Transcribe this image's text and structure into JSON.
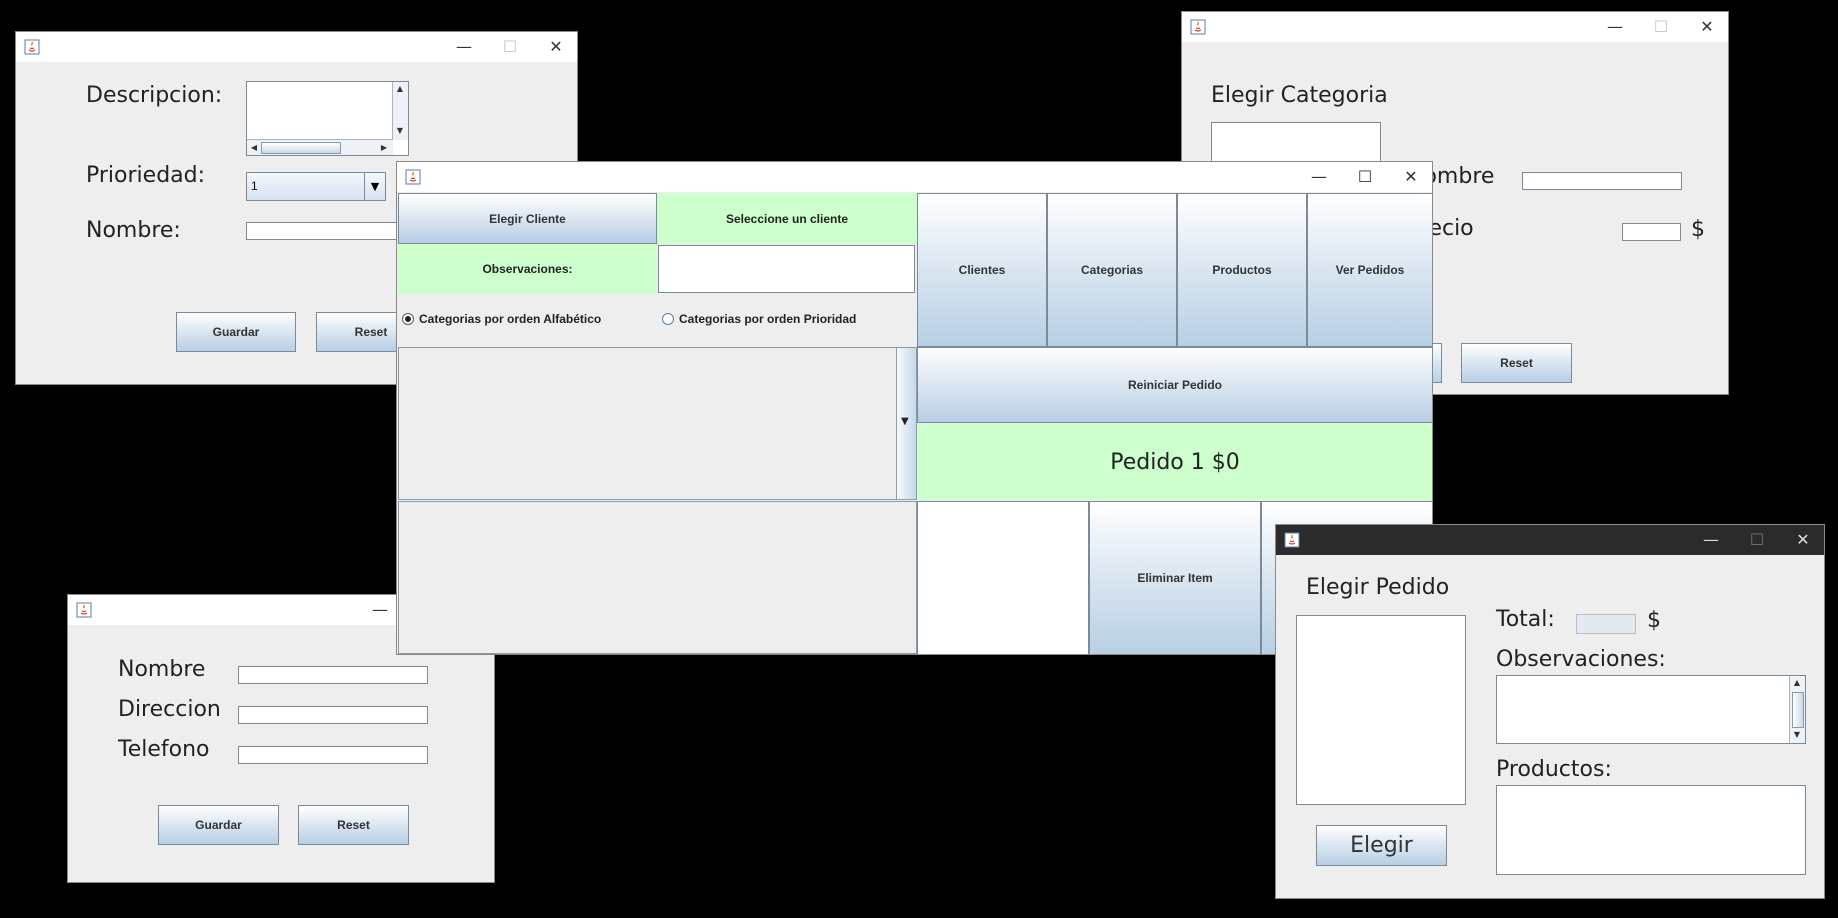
{
  "window_controls": {
    "minimize": "—",
    "maximize": "☐",
    "close": "✕"
  },
  "categoria_form": {
    "descripcion_label": "Descripcion:",
    "prioridad_label": "Prioriedad:",
    "prioridad_value": "1",
    "nombre_label": "Nombre:",
    "guardar": "Guardar",
    "reset": "Reset"
  },
  "producto_form": {
    "elegir_categoria_label": "Elegir Categoria",
    "nombre_label": "Nombre",
    "precio_label": "Precio",
    "currency": "$",
    "reset": "Reset"
  },
  "main": {
    "elegir_cliente": "Elegir Cliente",
    "seleccione_cliente": "Seleccione un cliente",
    "observaciones_label": "Observaciones:",
    "radio_alfabetico": "Categorias por orden Alfabético",
    "radio_prioridad": "Categorias por orden Prioridad",
    "nav_clientes": "Clientes",
    "nav_categorias": "Categorias",
    "nav_productos": "Productos",
    "nav_ver_pedidos": "Ver Pedidos",
    "reiniciar_pedido": "Reiniciar Pedido",
    "pedido_status": "Pedido 1 $0",
    "eliminar_item": "Eliminar Item"
  },
  "cliente_form": {
    "nombre_label": "Nombre",
    "direccion_label": "Direccion",
    "telefono_label": "Telefono",
    "guardar": "Guardar",
    "reset": "Reset"
  },
  "pedidos_window": {
    "elegir_pedido_label": "Elegir Pedido",
    "total_label": "Total:",
    "currency": "$",
    "observaciones_label": "Observaciones:",
    "productos_label": "Productos:",
    "elegir_button": "Elegir"
  },
  "colors": {
    "highlight_green": "#ccffcc",
    "button_gradient_bottom": "#b8cfe5",
    "desktop": "#000000"
  }
}
